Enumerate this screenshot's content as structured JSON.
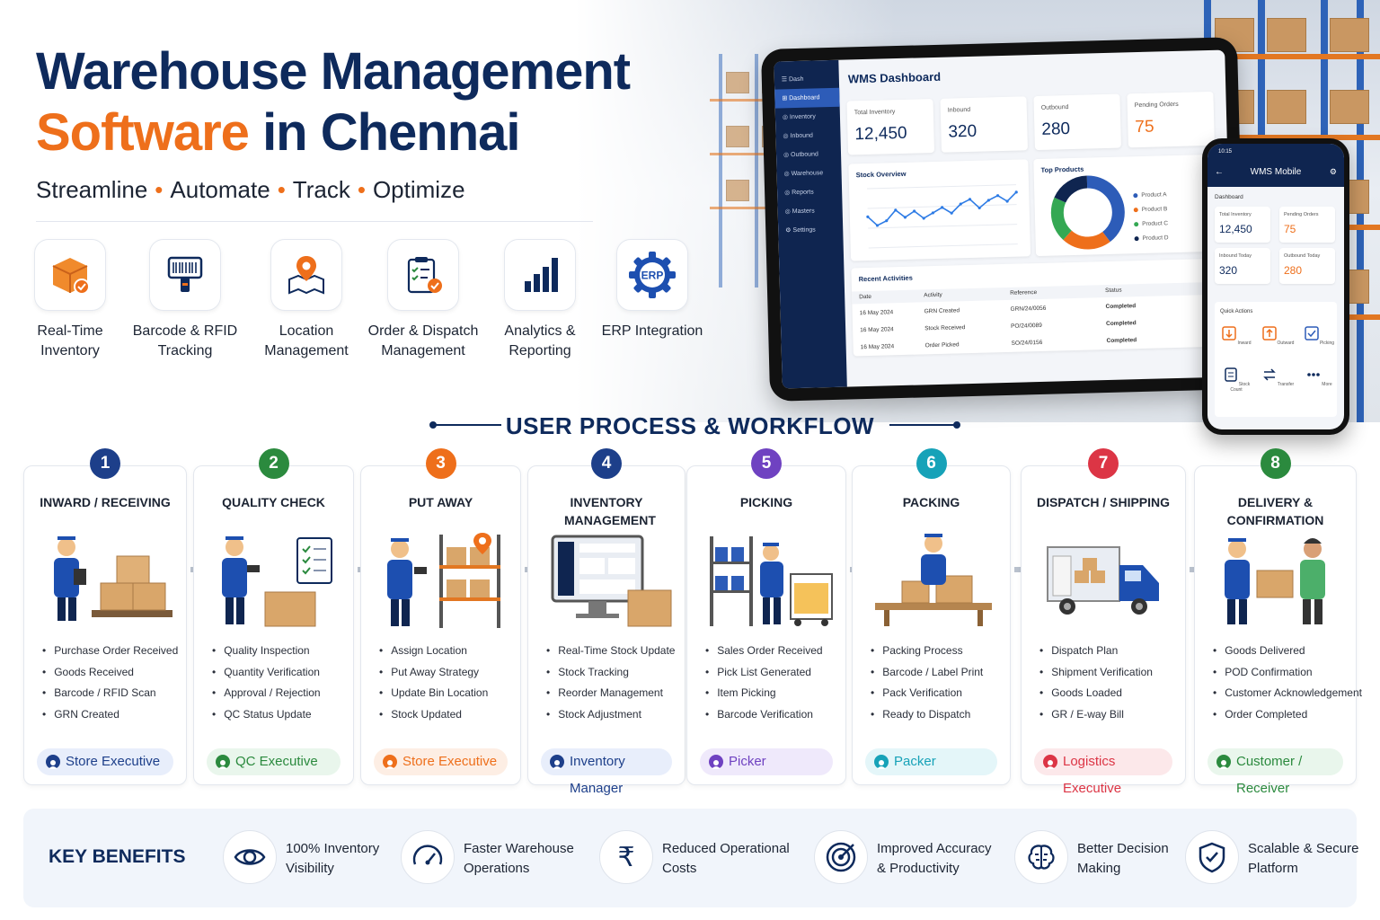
{
  "hero": {
    "title_line1": "Warehouse Management",
    "title_line2_highlight": "Software",
    "title_line2_rest": " in Chennai",
    "tagline": [
      "Streamline",
      "Automate",
      "Track",
      "Optimize"
    ],
    "tagline_separator": "•"
  },
  "features": [
    {
      "label": "Real-Time Inventory",
      "icon": "inventory-box-icon"
    },
    {
      "label": "Barcode & RFID Tracking",
      "icon": "barcode-scanner-icon"
    },
    {
      "label": "Location Management",
      "icon": "map-pin-icon"
    },
    {
      "label": "Order & Dispatch Management",
      "icon": "clipboard-check-icon"
    },
    {
      "label": "Analytics & Reporting",
      "icon": "bar-chart-icon"
    },
    {
      "label": "ERP Integration",
      "icon": "erp-gear-icon"
    }
  ],
  "dashboard": {
    "app_label": "Dash",
    "title": "WMS Dashboard",
    "nav": [
      "Dashboard",
      "Inventory",
      "Inbound",
      "Outbound",
      "Warehouse",
      "Reports",
      "Masters",
      "Settings"
    ],
    "kpis": [
      {
        "label": "Total Inventory",
        "value": "12,450",
        "color": "#0e2a5c"
      },
      {
        "label": "Inbound",
        "value": "320",
        "color": "#0e2a5c"
      },
      {
        "label": "Outbound",
        "value": "280",
        "color": "#0e2a5c"
      },
      {
        "label": "Pending Orders",
        "value": "75",
        "color": "#ee6f1b"
      }
    ],
    "stock_overview_title": "Stock Overview",
    "stock_overview_series": [
      42,
      30,
      36,
      50,
      40,
      48,
      38,
      45,
      52,
      44,
      56,
      62,
      50,
      60,
      66,
      58,
      70
    ],
    "top_products_title": "Top Products",
    "top_products": [
      {
        "name": "Product A",
        "share": 40,
        "color": "#2d5cb8"
      },
      {
        "name": "Product B",
        "share": 22,
        "color": "#ee6f1b"
      },
      {
        "name": "Product C",
        "share": 20,
        "color": "#34a853"
      },
      {
        "name": "Product D",
        "share": 18,
        "color": "#0f2550"
      }
    ],
    "activities_title": "Recent Activities",
    "activity_headers": [
      "Date",
      "Activity",
      "Reference",
      "Status"
    ],
    "activities": [
      {
        "date": "16 May 2024",
        "activity": "GRN Created",
        "reference": "GRN/24/0056",
        "status": "Completed"
      },
      {
        "date": "16 May 2024",
        "activity": "Stock Received",
        "reference": "PO/24/0089",
        "status": "Completed"
      },
      {
        "date": "16 May 2024",
        "activity": "Order Picked",
        "reference": "SO/24/0156",
        "status": "Completed"
      }
    ]
  },
  "mobile": {
    "time": "10:15",
    "title": "WMS Mobile",
    "section": "Dashboard",
    "kpis": [
      {
        "label": "Total Inventory",
        "value": "12,450",
        "color": "#0e2a5c"
      },
      {
        "label": "Pending Orders",
        "value": "75",
        "color": "#ee6f1b"
      },
      {
        "label": "Inbound Today",
        "value": "320",
        "color": "#0e2a5c"
      },
      {
        "label": "Outbound Today",
        "value": "280",
        "color": "#ee6f1b"
      }
    ],
    "quick_actions_title": "Quick Actions",
    "quick_actions": [
      "Inward",
      "Outward",
      "Picking",
      "Stock Count",
      "Transfer",
      "More"
    ]
  },
  "workflow": {
    "title": "USER PROCESS & WORKFLOW",
    "steps": [
      {
        "num": "1",
        "title": "INWARD / RECEIVING",
        "color": "#1d3f8a",
        "pill_bg": "#e8eefb",
        "bullets": [
          "Purchase Order Received",
          "Goods Received",
          "Barcode / RFID Scan",
          "GRN Created"
        ],
        "role": "Store Executive"
      },
      {
        "num": "2",
        "title": "QUALITY CHECK",
        "color": "#2b8a3e",
        "pill_bg": "#e9f6ec",
        "bullets": [
          "Quality Inspection",
          "Quantity Verification",
          "Approval / Rejection",
          "QC Status Update"
        ],
        "role": "QC Executive"
      },
      {
        "num": "3",
        "title": "PUT AWAY",
        "color": "#ee6f1b",
        "pill_bg": "#fdeee4",
        "bullets": [
          "Assign Location",
          "Put Away Strategy",
          "Update Bin Location",
          "Stock Updated"
        ],
        "role": "Store Executive"
      },
      {
        "num": "4",
        "title": "INVENTORY MANAGEMENT",
        "color": "#1d3f8a",
        "pill_bg": "#e8eefb",
        "bullets": [
          "Real-Time Stock Update",
          "Stock Tracking",
          "Reorder Management",
          "Stock Adjustment"
        ],
        "role": "Inventory Manager"
      },
      {
        "num": "5",
        "title": "PICKING",
        "color": "#6f42c1",
        "pill_bg": "#efe9fb",
        "bullets": [
          "Sales Order Received",
          "Pick List Generated",
          "Item Picking",
          "Barcode Verification"
        ],
        "role": "Picker"
      },
      {
        "num": "6",
        "title": "PACKING",
        "color": "#17a2b8",
        "pill_bg": "#e4f6f9",
        "bullets": [
          "Packing Process",
          "Barcode / Label Print",
          "Pack Verification",
          "Ready to Dispatch"
        ],
        "role": "Packer"
      },
      {
        "num": "7",
        "title": "DISPATCH / SHIPPING",
        "color": "#dc3545",
        "pill_bg": "#fce8ea",
        "bullets": [
          "Dispatch Plan",
          "Shipment Verification",
          "Goods Loaded",
          "GR / E-way Bill"
        ],
        "role": "Logistics Executive"
      },
      {
        "num": "8",
        "title": "DELIVERY & CONFIRMATION",
        "color": "#2b8a3e",
        "pill_bg": "#e9f6ec",
        "bullets": [
          "Goods Delivered",
          "POD Confirmation",
          "Customer Acknowledgement",
          "Order Completed"
        ],
        "role": "Customer / Receiver"
      }
    ]
  },
  "benefits": {
    "title": "KEY BENEFITS",
    "items": [
      {
        "line1": "100% Inventory",
        "line2": "Visibility",
        "icon": "eye-icon"
      },
      {
        "line1": "Faster Warehouse",
        "line2": "Operations",
        "icon": "speedometer-icon"
      },
      {
        "line1": "Reduced Operational",
        "line2": "Costs",
        "icon": "rupee-icon"
      },
      {
        "line1": "Improved Accuracy",
        "line2": "& Productivity",
        "icon": "target-icon"
      },
      {
        "line1": "Better Decision",
        "line2": "Making",
        "icon": "brain-icon"
      },
      {
        "line1": "Scalable & Secure",
        "line2": "Platform",
        "icon": "shield-check-icon"
      }
    ]
  },
  "colors": {
    "navy": "#0e2a5c",
    "orange": "#ee6f1b",
    "blue": "#2d5cb8"
  }
}
